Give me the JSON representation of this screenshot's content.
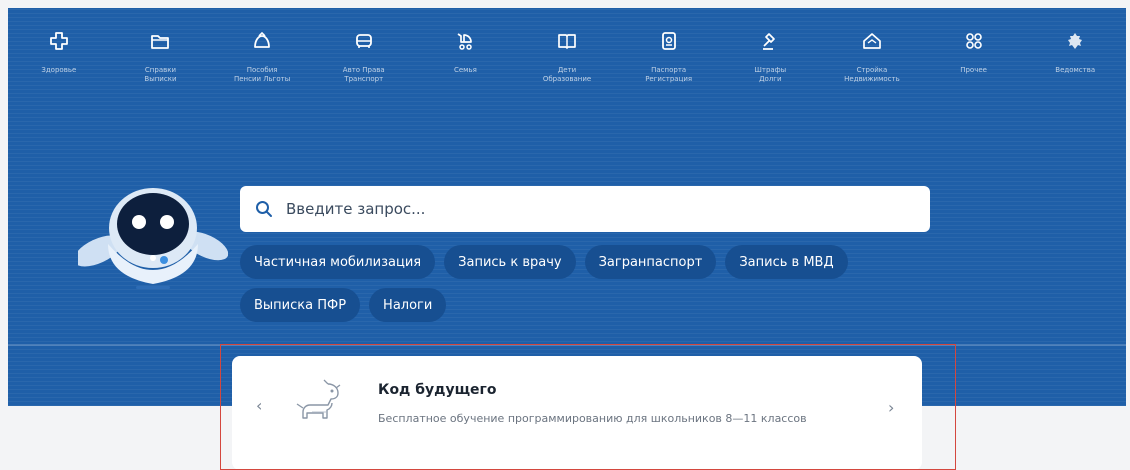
{
  "nav": {
    "items": [
      {
        "icon": "health-icon",
        "label": "Здоровье"
      },
      {
        "icon": "folder-icon",
        "label": "Справки\nВыписки"
      },
      {
        "icon": "benefits-icon",
        "label": "Пособия\nПенсии Льготы"
      },
      {
        "icon": "car-icon",
        "label": "Авто Права\nТранспорт"
      },
      {
        "icon": "stroller-icon",
        "label": "Семья"
      },
      {
        "icon": "book-icon",
        "label": "Дети\nОбразование"
      },
      {
        "icon": "passport-icon",
        "label": "Паспорта\nРегистрация"
      },
      {
        "icon": "gavel-icon",
        "label": "Штрафы\nДолги"
      },
      {
        "icon": "house-icon",
        "label": "Стройка\nНедвижимость"
      },
      {
        "icon": "grid-icon",
        "label": "Прочее"
      },
      {
        "icon": "emblem-icon",
        "label": "Ведомства"
      }
    ]
  },
  "search": {
    "placeholder": "Введите запрос..."
  },
  "chips": [
    "Частичная мобилизация",
    "Запись к врачу",
    "Загранпаспорт",
    "Запись в МВД",
    "Выписка ПФР",
    "Налоги"
  ],
  "card": {
    "title": "Код будущего",
    "description": "Бесплатное обучение программированию для школьников 8—11 классов",
    "prev": "‹",
    "next": "›"
  },
  "colors": {
    "hero": "#1f5fa8",
    "chip": "#174f91",
    "highlight": "#d4473e"
  }
}
